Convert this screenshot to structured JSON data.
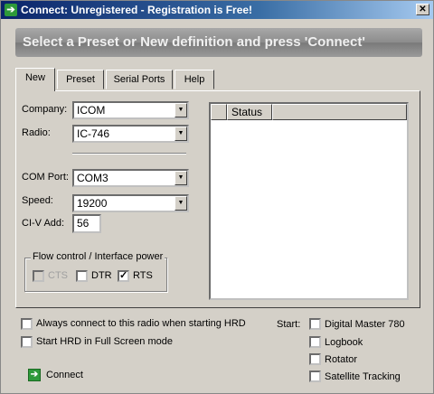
{
  "window": {
    "title": "Connect: Unregistered - Registration is Free!",
    "close_glyph": "✕"
  },
  "banner": "Select a Preset or New definition and press 'Connect'",
  "tabs": [
    {
      "label": "New",
      "active": true
    },
    {
      "label": "Preset",
      "active": false
    },
    {
      "label": "Serial Ports",
      "active": false
    },
    {
      "label": "Help",
      "active": false
    }
  ],
  "form": {
    "company_label": "Company:",
    "company_value": "ICOM",
    "radio_label": "Radio:",
    "radio_value": "IC-746",
    "com_port_label": "COM Port:",
    "com_port_value": "COM3",
    "speed_label": "Speed:",
    "speed_value": "19200",
    "civ_label": "CI-V Add:",
    "civ_value": "56"
  },
  "flow": {
    "title": "Flow control / Interface power",
    "cts": {
      "label": "CTS",
      "checked": false,
      "enabled": false
    },
    "dtr": {
      "label": "DTR",
      "checked": false,
      "enabled": true
    },
    "rts": {
      "label": "RTS",
      "checked": true,
      "enabled": true
    }
  },
  "status_header": "Status",
  "options": {
    "always_connect": "Always connect to this radio when starting HRD",
    "full_screen": "Start HRD in Full Screen mode"
  },
  "start": {
    "label": "Start:",
    "items": [
      "Digital Master 780",
      "Logbook",
      "Rotator",
      "Satellite Tracking"
    ]
  },
  "connect_label": "Connect",
  "icons": {
    "app": "arrow-right-icon",
    "connect": "arrow-right-icon",
    "dropdown": "chevron-down-icon"
  },
  "colors": {
    "titlebar": "#0a246a",
    "icon_green": "#2e9a3a",
    "face": "#d4d0c8"
  }
}
